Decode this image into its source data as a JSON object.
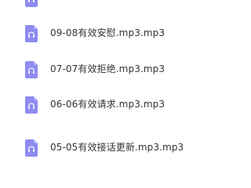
{
  "colors": {
    "icon": "#8E8BF2",
    "icon_fold": "#B7B5F7",
    "text": "#333333",
    "background": "#FFFFFF"
  },
  "file_list": {
    "items": [
      {
        "name": "",
        "icon": "headphones-icon"
      },
      {
        "name": "09-08有效安慰.mp3.mp3",
        "icon": "headphones-icon"
      },
      {
        "name": "07-07有效拒绝.mp3.mp3",
        "icon": "headphones-icon"
      },
      {
        "name": "06-06有效请求.mp3.mp3",
        "icon": "headphones-icon"
      },
      {
        "name": "05-05有效接话更新.mp3.mp3",
        "icon": "headphones-icon"
      }
    ]
  }
}
